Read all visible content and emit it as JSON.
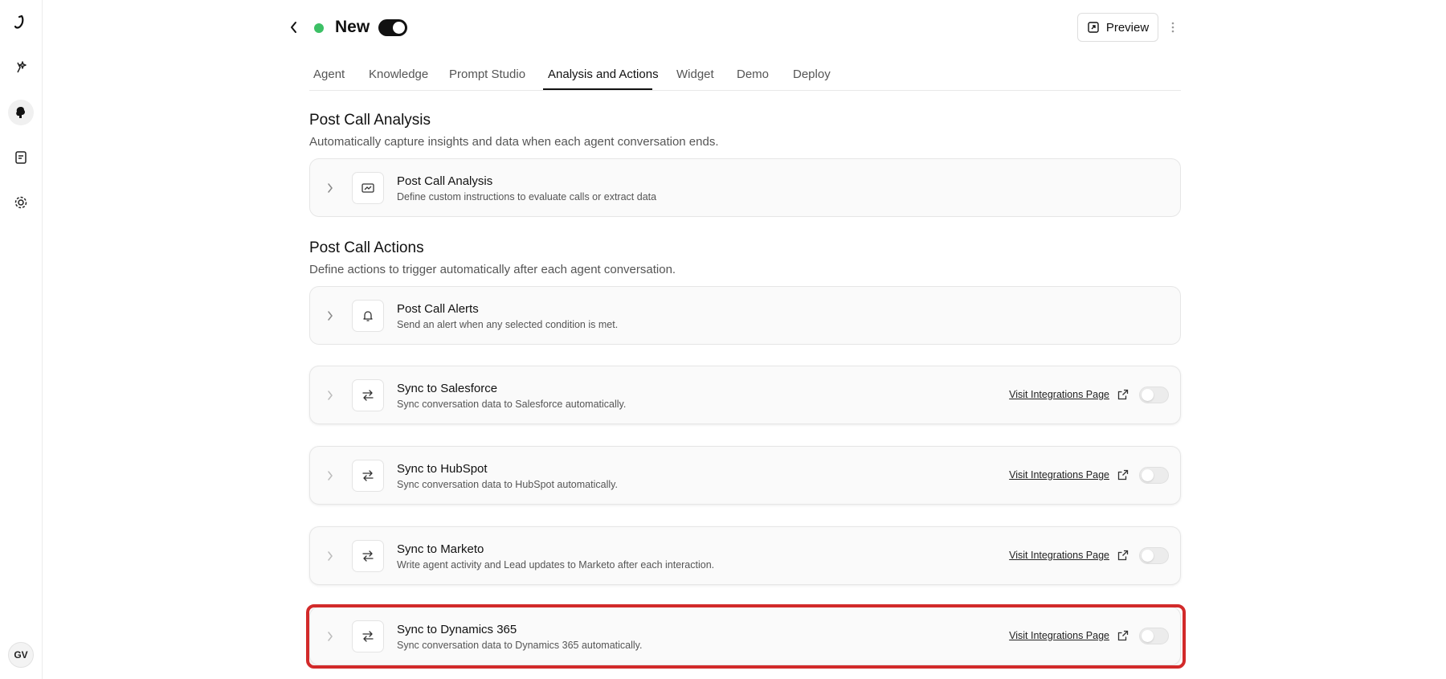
{
  "sidebar": {
    "items": [
      {
        "icon": "logo-icon"
      },
      {
        "icon": "sparkle-agent-icon"
      },
      {
        "icon": "brain-icon"
      },
      {
        "icon": "book-icon"
      },
      {
        "icon": "gear-icon"
      }
    ],
    "avatar_initials": "GV"
  },
  "header": {
    "title": "New",
    "status_color": "#3cc065",
    "enabled": true,
    "preview_label": "Preview"
  },
  "tabs": [
    {
      "label": "Agent"
    },
    {
      "label": "Knowledge"
    },
    {
      "label": "Prompt Studio"
    },
    {
      "label": "Analysis and Actions",
      "active": true
    },
    {
      "label": "Widget"
    },
    {
      "label": "Demo"
    },
    {
      "label": "Deploy"
    }
  ],
  "post_call_analysis": {
    "title": "Post Call Analysis",
    "subtitle": "Automatically capture insights and data when each agent conversation ends.",
    "card": {
      "title": "Post Call Analysis",
      "description": "Define custom instructions to evaluate calls or extract data",
      "icon": "analysis-icon"
    }
  },
  "post_call_actions": {
    "title": "Post Call Actions",
    "subtitle": "Define actions to trigger automatically after each agent conversation.",
    "alerts": {
      "title": "Post Call Alerts",
      "description": "Send an alert when any selected condition is met.",
      "icon": "bell-icon"
    },
    "integrations": [
      {
        "title": "Sync to Salesforce",
        "description": "Sync conversation data to Salesforce automatically.",
        "link": "Visit Integrations Page",
        "enabled": false
      },
      {
        "title": "Sync to HubSpot",
        "description": "Sync conversation data to HubSpot automatically.",
        "link": "Visit Integrations Page",
        "enabled": false
      },
      {
        "title": "Sync to Marketo",
        "description": "Write agent activity and Lead updates to Marketo after each interaction.",
        "link": "Visit Integrations Page",
        "enabled": false
      },
      {
        "title": "Sync to Dynamics 365",
        "description": "Sync conversation data to Dynamics 365 automatically.",
        "link": "Visit Integrations Page",
        "enabled": false,
        "highlighted": true
      }
    ]
  },
  "colors": {
    "highlight": "#d22a2a",
    "accent": "#111111"
  }
}
